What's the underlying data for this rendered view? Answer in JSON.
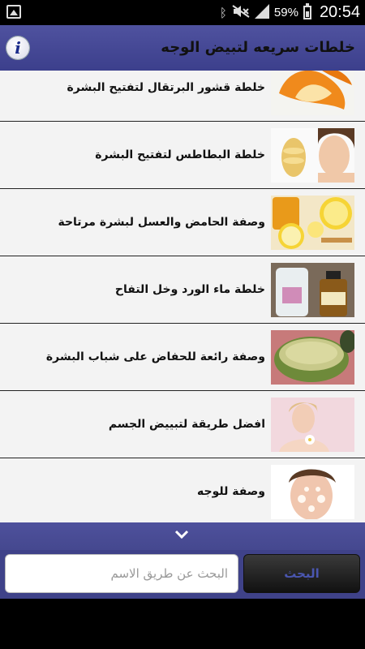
{
  "status_bar": {
    "left_icon": "gallery-icon",
    "icons": [
      "bluetooth-icon",
      "mute-icon",
      "signal-icon"
    ],
    "battery": "59%",
    "time": "20:54"
  },
  "header": {
    "title": "خلطات سريعه لتبيض الوجه",
    "info_icon": "info-icon"
  },
  "list": {
    "items": [
      {
        "label": "خلطة قشور البرتقال لتفتيح البشرة",
        "image": "orange-peel"
      },
      {
        "label": "خلطة البطاطس لتفتيح البشرة",
        "image": "potato-face"
      },
      {
        "label": "وصفة الحامض والعسل لبشرة مرتاحة",
        "image": "lemon-honey"
      },
      {
        "label": "خلطة ماء الورد وخل التفاح",
        "image": "rosewater-vinegar"
      },
      {
        "label": "وصفة رائعة للحفاض على شباب البشرة",
        "image": "avocado-mask"
      },
      {
        "label": "افضل طريقة لتبييض الجسم",
        "image": "woman-flower"
      },
      {
        "label": "وصفة للوجه",
        "image": "face-mask"
      }
    ]
  },
  "search": {
    "placeholder": "البحث عن طريق الاسم",
    "value": "",
    "button_label": "البحث"
  },
  "colors": {
    "header": "#4f529f",
    "panel": "#3f4289",
    "list_bg": "#f3f3f3"
  }
}
